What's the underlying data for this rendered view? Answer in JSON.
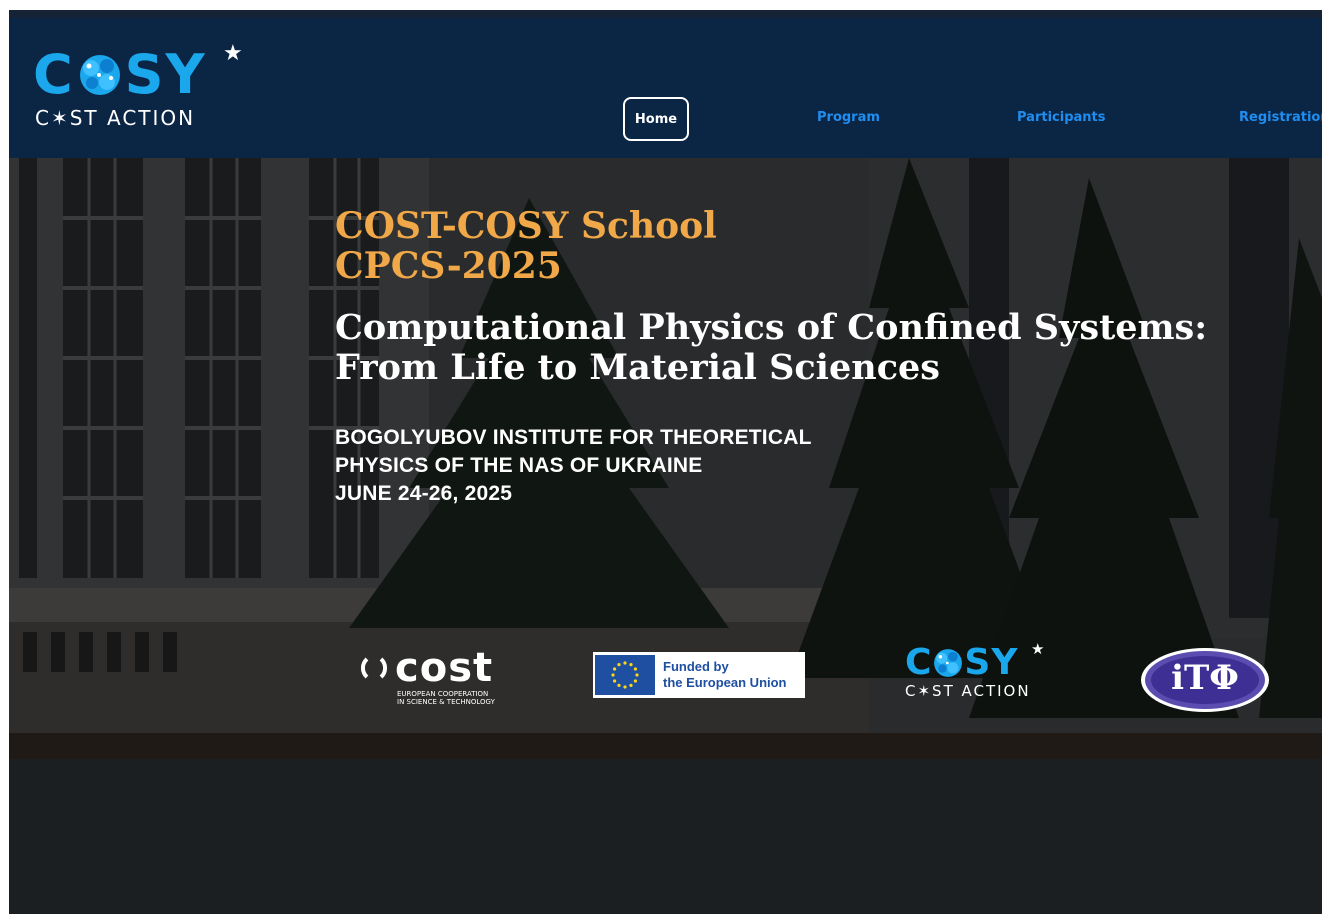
{
  "header": {
    "logo": {
      "word_prefix": "C",
      "word_suffix": "SY",
      "sub": "C✶ST ACTION"
    },
    "nav": {
      "home": "Home",
      "program": "Program",
      "participants": "Participants",
      "registration": "Registration"
    }
  },
  "hero": {
    "school_line1": "COST-COSY School",
    "school_line2": "CPCS-2025",
    "title_line1": "Computational Physics of Confined Systems:",
    "title_line2": "From Life to Material Sciences",
    "venue_line1": "BOGOLYUBOV INSTITUTE FOR THEORETICAL",
    "venue_line2": "PHYSICS OF THE NAS OF UKRAINE",
    "date": "JUNE 24-26, 2025"
  },
  "partners": {
    "cost_word": "cost",
    "cost_tag_line1": "EUROPEAN COOPERATION",
    "cost_tag_line2": "IN SCIENCE & TECHNOLOGY",
    "eu_line1": "Funded by",
    "eu_line2": "the European Union",
    "cosy_word_prefix": "C",
    "cosy_word_suffix": "SY",
    "cosy_sub": "C✶ST ACTION",
    "itp_text": "iTΦ"
  },
  "colors": {
    "navbar": "#0b2545",
    "accent_blue": "#1aa7ec",
    "nav_link": "#1f8ef0",
    "school_orange": "#f0a848",
    "eu_blue": "#1f4fa0"
  }
}
